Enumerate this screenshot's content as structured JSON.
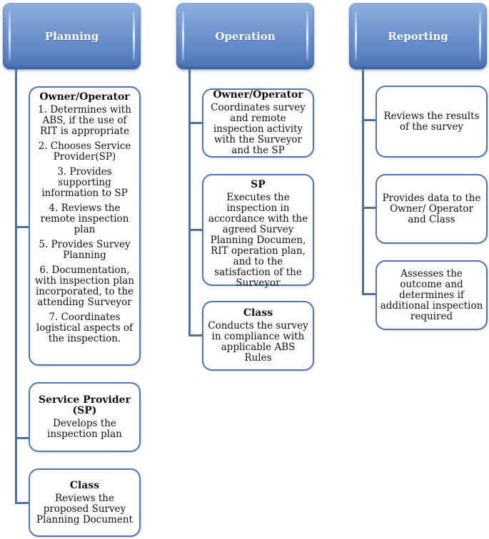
{
  "columns": [
    {
      "header": "Planning",
      "boxes": [
        {
          "title": "Owner/Operator",
          "items": [
            "1. Determines with ABS, if the use of RIT is appropriate",
            "2. Chooses Service Provider(SP)",
            "3. Provides supporting information to SP",
            "4. Reviews the remote inspection plan",
            "5.  Provides Survey Planning",
            "6. Documentation, with inspection plan incorporated, to the attending Surveyor",
            "7. Coordinates logistical aspects of the inspection."
          ]
        },
        {
          "title": "Service Provider (SP)",
          "items": [
            "Develops the inspection plan"
          ]
        },
        {
          "title": "Class",
          "items": [
            "Reviews the proposed Survey Planning Document"
          ]
        }
      ]
    },
    {
      "header": "Operation",
      "boxes": [
        {
          "title": "Owner/Operator",
          "items": [
            "Coordinates survey and remote inspection activity with the Surveyor and the SP"
          ]
        },
        {
          "title": "SP",
          "items": [
            "Executes the inspection in accordance with the agreed Survey Planning Documen, RIT operation plan, and to the satisfaction of the Surveyor"
          ]
        },
        {
          "title": "Class",
          "items": [
            "Conducts the survey in compliance with applicable ABS Rules"
          ]
        }
      ]
    },
    {
      "header": "Reporting",
      "boxes": [
        {
          "items": [
            "Reviews  the results of the survey"
          ]
        },
        {
          "items": [
            "Provides data to the Owner/ Operator and Class"
          ]
        },
        {
          "items": [
            "Assesses the outcome and determines if additional inspection required"
          ]
        }
      ]
    }
  ]
}
